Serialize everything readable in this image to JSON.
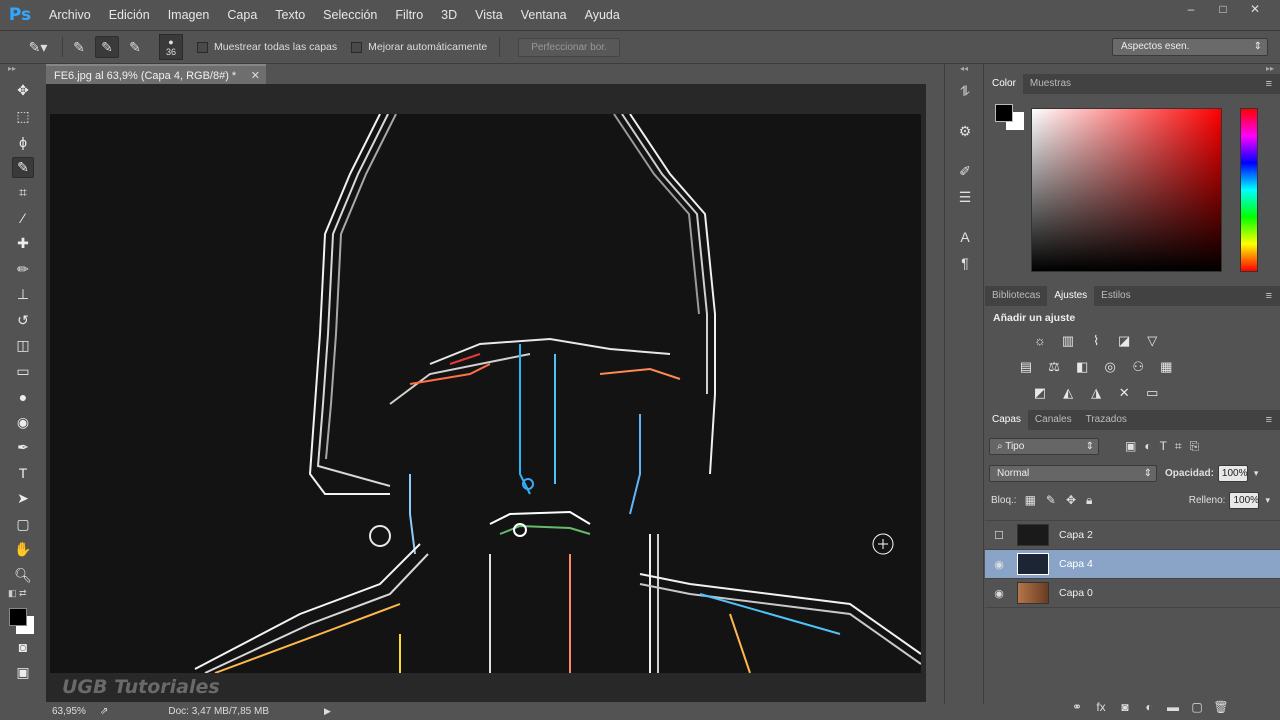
{
  "app": {
    "logo": "Ps",
    "menu": [
      "Archivo",
      "Edición",
      "Imagen",
      "Capa",
      "Texto",
      "Selección",
      "Filtro",
      "3D",
      "Vista",
      "Ventana",
      "Ayuda"
    ]
  },
  "window_controls": [
    "–",
    "□",
    "✕"
  ],
  "options": {
    "brush_size": "36",
    "sample_all_label": "Muestrear todas las capas",
    "auto_enhance_label": "Mejorar automáticamente",
    "refine_edge_label": "Perfeccionar bor.",
    "workspace": "Aspectos esen."
  },
  "document": {
    "tab_title": "FE6.jpg al 63,9% (Capa 4, RGB/8#) *",
    "close": "✕",
    "watermark": "UGB Tutoriales"
  },
  "status": {
    "zoom": "63,95%",
    "doc_size": "Doc: 3,47 MB/7,85 MB"
  },
  "color_panel": {
    "tabs": [
      "Color",
      "Muestras"
    ],
    "foreground": "#000000",
    "background": "#ffffff"
  },
  "adjust_panel": {
    "tabs": [
      "Bibliotecas",
      "Ajustes",
      "Estilos"
    ],
    "heading": "Añadir un ajuste"
  },
  "layers_panel": {
    "tabs": [
      "Capas",
      "Canales",
      "Trazados"
    ],
    "filter": "Tipo",
    "blend_mode": "Normal",
    "opacity_label": "Opacidad:",
    "opacity": "100%",
    "lock_label": "Bloq.:",
    "fill_label": "Relleno:",
    "fill": "100%",
    "layers": [
      {
        "name": "Capa 2",
        "visible": false,
        "selected": false
      },
      {
        "name": "Capa 4",
        "visible": true,
        "selected": true
      },
      {
        "name": "Capa 0",
        "visible": true,
        "selected": false
      }
    ]
  },
  "colors": {
    "accent": "#31a8ff",
    "selected_layer": "#8aa4c8",
    "canvas_bg": "#131313"
  }
}
